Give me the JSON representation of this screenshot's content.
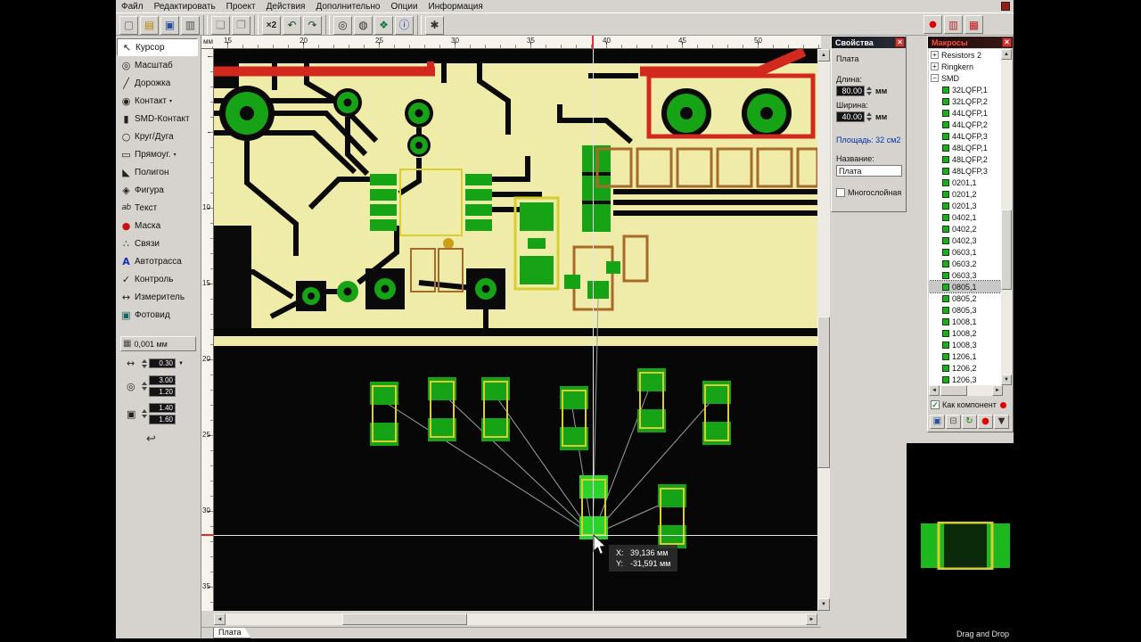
{
  "menubar": {
    "items": [
      "Файл",
      "Редактировать",
      "Проект",
      "Действия",
      "Дополнительно",
      "Опции",
      "Информация"
    ]
  },
  "toolbar": {
    "buttons": [
      {
        "icon": "new-icon"
      },
      {
        "icon": "open-icon"
      },
      {
        "icon": "save-icon"
      },
      {
        "icon": "print-icon"
      },
      {
        "sep": true
      },
      {
        "icon": "copy-icon"
      },
      {
        "icon": "paste-icon"
      },
      {
        "sep": true
      },
      {
        "text": "×2"
      },
      {
        "icon": "undo-icon"
      },
      {
        "icon": "redo-icon"
      },
      {
        "sep": true
      },
      {
        "icon": "zoom-in-icon"
      },
      {
        "icon": "zoom-page-icon"
      },
      {
        "icon": "components-icon"
      },
      {
        "icon": "info-icon"
      },
      {
        "sep": true
      },
      {
        "icon": "settings-icon"
      }
    ],
    "right_buttons": [
      {
        "icon": "record-icon"
      },
      {
        "icon": "layers-badge-icon"
      },
      {
        "icon": "drc-badge-icon"
      }
    ]
  },
  "left_tools": {
    "items": [
      {
        "icon": "cursor-icon",
        "label": "Курсор",
        "selected": true
      },
      {
        "icon": "zoom-icon",
        "label": "Масштаб"
      },
      {
        "icon": "track-icon",
        "label": "Дорожка"
      },
      {
        "icon": "pad-icon",
        "label": "Контакт",
        "dropdown": true
      },
      {
        "icon": "smd-pad-icon",
        "label": "SMD-Контакт"
      },
      {
        "icon": "circle-icon",
        "label": "Круг/Дуга"
      },
      {
        "icon": "rect-icon",
        "label": "Прямоуг.",
        "dropdown": true
      },
      {
        "icon": "polygon-icon",
        "label": "Полигон"
      },
      {
        "icon": "shape-icon",
        "label": "Фигура"
      },
      {
        "icon": "text-icon",
        "label": "Текст"
      },
      {
        "icon": "mask-icon",
        "label": "Маска"
      },
      {
        "icon": "net-icon",
        "label": "Связи"
      },
      {
        "icon": "autoroute-icon",
        "label": "Автотрасса"
      },
      {
        "icon": "check-icon",
        "label": "Контроль"
      },
      {
        "icon": "measure-icon",
        "label": "Измеритель"
      },
      {
        "icon": "photo-icon",
        "label": "Фотовид"
      }
    ],
    "grid_label": "0,001 мм",
    "track_width": "0.30",
    "pad_outer": "3.00",
    "pad_inner": "1.20",
    "smd_width": "1.40",
    "smd_height": "1.60"
  },
  "rulers": {
    "corner": "мм",
    "horizontal": [
      "15",
      "20",
      "25",
      "30",
      "35",
      "40",
      "45",
      "50"
    ],
    "vertical": [
      "10",
      "15",
      "20",
      "25",
      "30",
      "35"
    ]
  },
  "canvas": {
    "tooltip": {
      "x_label": "X:",
      "x_value": "39,136 мм",
      "y_label": "Y:",
      "y_value": "-31,591 мм"
    }
  },
  "properties_panel": {
    "title": "Свойства",
    "section_title": "Плата",
    "length_label": "Длина:",
    "length_value": "80.00",
    "length_unit": "мм",
    "width_label": "Ширина:",
    "width_value": "40.00",
    "width_unit": "мм",
    "area_text": "Площадь: 32 см2",
    "name_label": "Название:",
    "name_value": "Плата",
    "multilayer_label": "Многослойная"
  },
  "macros_panel": {
    "title": "Макросы",
    "tree": [
      {
        "label": "Resistors 2",
        "level": 0,
        "expander": "+"
      },
      {
        "label": "Ringkern",
        "level": 0,
        "expander": "+"
      },
      {
        "label": "SMD",
        "level": 0,
        "expander": "−"
      },
      {
        "label": "32LQFP,1",
        "level": 1
      },
      {
        "label": "32LQFP,2",
        "level": 1
      },
      {
        "label": "44LQFP,1",
        "level": 1
      },
      {
        "label": "44LQFP,2",
        "level": 1
      },
      {
        "label": "44LQFP,3",
        "level": 1
      },
      {
        "label": "48LQFP,1",
        "level": 1
      },
      {
        "label": "48LQFP,2",
        "level": 1
      },
      {
        "label": "48LQFP,3",
        "level": 1
      },
      {
        "label": "0201,1",
        "level": 1
      },
      {
        "label": "0201,2",
        "level": 1
      },
      {
        "label": "0201,3",
        "level": 1
      },
      {
        "label": "0402,1",
        "level": 1
      },
      {
        "label": "0402,2",
        "level": 1
      },
      {
        "label": "0402,3",
        "level": 1
      },
      {
        "label": "0603,1",
        "level": 1
      },
      {
        "label": "0603,2",
        "level": 1
      },
      {
        "label": "0603,3",
        "level": 1
      },
      {
        "label": "0805,1",
        "level": 1,
        "selected": true
      },
      {
        "label": "0805,2",
        "level": 1
      },
      {
        "label": "0805,3",
        "level": 1
      },
      {
        "label": "1008,1",
        "level": 1
      },
      {
        "label": "1008,2",
        "level": 1
      },
      {
        "label": "1008,3",
        "level": 1
      },
      {
        "label": "1206,1",
        "level": 1
      },
      {
        "label": "1206,2",
        "level": 1
      },
      {
        "label": "1206,3",
        "level": 1
      }
    ],
    "as_component_label": "Как компонент",
    "buttons": [
      {
        "icon": "disk-icon"
      },
      {
        "icon": "trash-icon"
      },
      {
        "icon": "rotate-icon"
      },
      {
        "icon": "red-dot-icon"
      },
      {
        "icon": "filter-icon"
      }
    ],
    "preview_hint": "Drag and Drop"
  },
  "tabbar": {
    "active_tab": "Плата"
  },
  "colors": {
    "copper_pour": "#efeba9",
    "pad_green": "#16a316",
    "trace_red": "#d2281e",
    "outline_yellow": "#d8ce2e",
    "window_gray": "#d6d3ce"
  }
}
